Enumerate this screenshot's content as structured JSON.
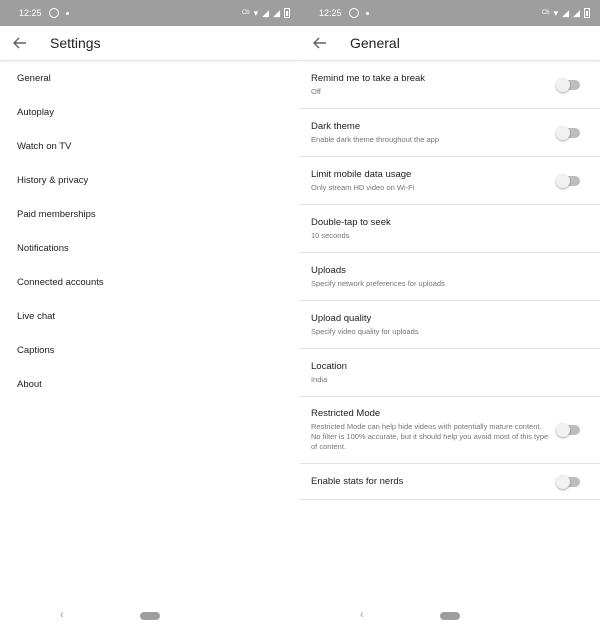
{
  "status": {
    "time": "12:25",
    "carrier": "Cb"
  },
  "left": {
    "title": "Settings",
    "items": [
      {
        "label": "General"
      },
      {
        "label": "Autoplay"
      },
      {
        "label": "Watch on TV"
      },
      {
        "label": "History & privacy"
      },
      {
        "label": "Paid memberships"
      },
      {
        "label": "Notifications"
      },
      {
        "label": "Connected accounts"
      },
      {
        "label": "Live chat"
      },
      {
        "label": "Captions"
      },
      {
        "label": "About"
      }
    ]
  },
  "right": {
    "title": "General",
    "items": [
      {
        "title": "Remind me to take a break",
        "sub": "Off",
        "toggle": "off"
      },
      {
        "title": "Dark theme",
        "sub": "Enable dark theme throughout the app",
        "toggle": "off"
      },
      {
        "title": "Limit mobile data usage",
        "sub": "Only stream HD video on Wi-Fi",
        "toggle": "off"
      },
      {
        "title": "Double-tap to seek",
        "sub": "10 seconds"
      },
      {
        "title": "Uploads",
        "sub": "Specify network preferences for uploads"
      },
      {
        "title": "Upload quality",
        "sub": "Specify video quality for uploads"
      },
      {
        "title": "Location",
        "sub": "India"
      },
      {
        "title": "Restricted Mode",
        "sub": "Restricted Mode can help hide videos with potentially mature content. No filter is 100% accurate, but it should help you avoid most of this type of content.",
        "toggle": "off"
      },
      {
        "title": "Enable stats for nerds",
        "toggle": "off"
      }
    ]
  },
  "colors": {
    "statusbar": "#9e9e9e",
    "toggle_track": "#bdbdbd",
    "divider": "#e3e3e3"
  },
  "icons": {
    "back": "arrow-left-icon",
    "nav_back": "nav-back-icon",
    "nav_home": "home-pill-icon"
  }
}
